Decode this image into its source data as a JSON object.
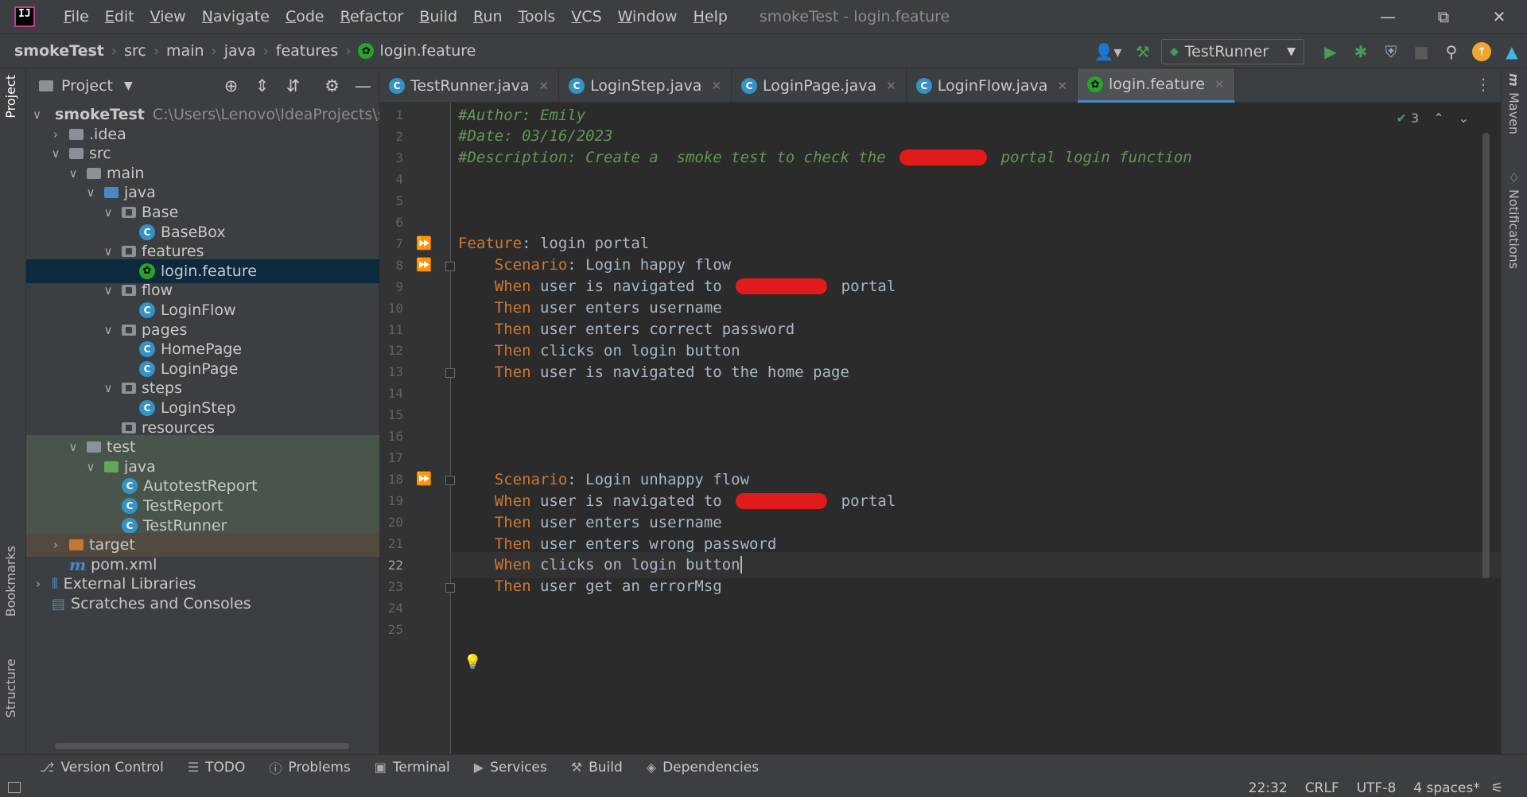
{
  "app": {
    "menu": [
      "File",
      "Edit",
      "View",
      "Navigate",
      "Code",
      "Refactor",
      "Build",
      "Run",
      "Tools",
      "VCS",
      "Window",
      "Help"
    ],
    "window_title": "smokeTest - login.feature"
  },
  "breadcrumb": [
    "smokeTest",
    "src",
    "main",
    "java",
    "features",
    "login.feature"
  ],
  "toolbar": {
    "run_config": "TestRunner"
  },
  "left_stripe": {
    "project": "Project",
    "bookmarks": "Bookmarks",
    "structure": "Structure"
  },
  "right_stripe": {
    "maven": "Maven",
    "notifications": "Notifications"
  },
  "project_panel": {
    "title": "Project",
    "tree": [
      {
        "label": "smokeTest",
        "extra": "C:\\Users\\Lenovo\\IdeaProjects\\sm",
        "type": "folder"
      },
      {
        "label": ".idea",
        "type": "folder"
      },
      {
        "label": "src",
        "type": "folder"
      },
      {
        "label": "main",
        "type": "folder"
      },
      {
        "label": "java",
        "type": "folder-blue"
      },
      {
        "label": "Base",
        "type": "package"
      },
      {
        "label": "BaseBox",
        "type": "class"
      },
      {
        "label": "features",
        "type": "package"
      },
      {
        "label": "login.feature",
        "type": "feature"
      },
      {
        "label": "flow",
        "type": "package"
      },
      {
        "label": "LoginFlow",
        "type": "class"
      },
      {
        "label": "pages",
        "type": "package"
      },
      {
        "label": "HomePage",
        "type": "class"
      },
      {
        "label": "LoginPage",
        "type": "class"
      },
      {
        "label": "steps",
        "type": "package"
      },
      {
        "label": "LoginStep",
        "type": "class"
      },
      {
        "label": "resources",
        "type": "resources"
      },
      {
        "label": "test",
        "type": "folder"
      },
      {
        "label": "java",
        "type": "folder-green"
      },
      {
        "label": "AutotestReport",
        "type": "class"
      },
      {
        "label": "TestReport",
        "type": "class"
      },
      {
        "label": "TestRunner",
        "type": "class"
      },
      {
        "label": "target",
        "type": "folder-orange"
      },
      {
        "label": "pom.xml",
        "type": "maven"
      },
      {
        "label": "External Libraries",
        "type": "libs"
      },
      {
        "label": "Scratches and Consoles",
        "type": "scratches"
      }
    ]
  },
  "tabs": [
    {
      "label": "TestRunner.java"
    },
    {
      "label": "LoginStep.java"
    },
    {
      "label": "LoginPage.java"
    },
    {
      "label": "LoginFlow.java"
    },
    {
      "label": "login.feature",
      "active": true
    }
  ],
  "editor": {
    "inspection_count": "3",
    "lines": [
      {
        "n": "1",
        "parts": [
          {
            "t": "#Author: Emily",
            "c": "comment"
          }
        ]
      },
      {
        "n": "2",
        "parts": [
          {
            "t": "#Date: 03/16/2023",
            "c": "comment"
          }
        ]
      },
      {
        "n": "3",
        "parts": [
          {
            "t": "#Description: Create a  smoke test to check the ",
            "c": "comment"
          },
          {
            "redact": 110
          },
          {
            "t": " portal login function",
            "c": "comment"
          }
        ]
      },
      {
        "n": "4",
        "parts": []
      },
      {
        "n": "5",
        "parts": []
      },
      {
        "n": "6",
        "parts": []
      },
      {
        "n": "7",
        "parts": [
          {
            "t": "Feature",
            "c": "kw"
          },
          {
            "t": ": login portal",
            "c": "text"
          }
        ]
      },
      {
        "n": "8",
        "parts": [
          {
            "t": "    Scenario",
            "c": "kw"
          },
          {
            "t": ": Login happy flow",
            "c": "text"
          }
        ]
      },
      {
        "n": "9",
        "parts": [
          {
            "t": "    When",
            "c": "kw"
          },
          {
            "t": " user is navigated to ",
            "c": "text"
          },
          {
            "redact": 115
          },
          {
            "t": " portal",
            "c": "text"
          }
        ]
      },
      {
        "n": "10",
        "parts": [
          {
            "t": "    Then",
            "c": "kw"
          },
          {
            "t": " user enters username",
            "c": "text"
          }
        ]
      },
      {
        "n": "11",
        "parts": [
          {
            "t": "    Then",
            "c": "kw"
          },
          {
            "t": " user enters correct password",
            "c": "text"
          }
        ]
      },
      {
        "n": "12",
        "parts": [
          {
            "t": "    Then",
            "c": "kw"
          },
          {
            "t": " clicks on login button",
            "c": "text"
          }
        ]
      },
      {
        "n": "13",
        "parts": [
          {
            "t": "    Then",
            "c": "kw"
          },
          {
            "t": " user is navigated to the home page",
            "c": "text"
          }
        ]
      },
      {
        "n": "14",
        "parts": []
      },
      {
        "n": "15",
        "parts": []
      },
      {
        "n": "16",
        "parts": []
      },
      {
        "n": "17",
        "parts": []
      },
      {
        "n": "18",
        "parts": [
          {
            "t": "    Scenario",
            "c": "kw"
          },
          {
            "t": ": Login unhappy flow",
            "c": "text"
          }
        ]
      },
      {
        "n": "19",
        "parts": [
          {
            "t": "    When",
            "c": "kw"
          },
          {
            "t": " user is navigated to ",
            "c": "text"
          },
          {
            "redact": 115
          },
          {
            "t": " portal",
            "c": "text"
          }
        ]
      },
      {
        "n": "20",
        "parts": [
          {
            "t": "    Then",
            "c": "kw"
          },
          {
            "t": " user enters username",
            "c": "text"
          }
        ]
      },
      {
        "n": "21",
        "parts": [
          {
            "t": "    Then",
            "c": "kw"
          },
          {
            "t": " user enters wrong password",
            "c": "text"
          }
        ]
      },
      {
        "n": "22",
        "parts": [
          {
            "t": "    When",
            "c": "kw"
          },
          {
            "t": " clicks on login button",
            "c": "text"
          },
          {
            "caret": true
          }
        ],
        "current": true
      },
      {
        "n": "23",
        "parts": [
          {
            "t": "    Then",
            "c": "kw"
          },
          {
            "t": " user get an errorMsg",
            "c": "text"
          }
        ]
      },
      {
        "n": "24",
        "parts": []
      },
      {
        "n": "25",
        "parts": []
      }
    ]
  },
  "bottom_tools": [
    {
      "label": "Version Control",
      "icon": "branch-icon"
    },
    {
      "label": "TODO",
      "icon": "list-icon"
    },
    {
      "label": "Problems",
      "icon": "problems-icon"
    },
    {
      "label": "Terminal",
      "icon": "terminal-icon"
    },
    {
      "label": "Services",
      "icon": "services-icon"
    },
    {
      "label": "Build",
      "icon": "hammer-icon"
    },
    {
      "label": "Dependencies",
      "icon": "layers-icon"
    }
  ],
  "status": {
    "position": "22:32",
    "line_sep": "CRLF",
    "encoding": "UTF-8",
    "indent": "4 spaces*"
  }
}
